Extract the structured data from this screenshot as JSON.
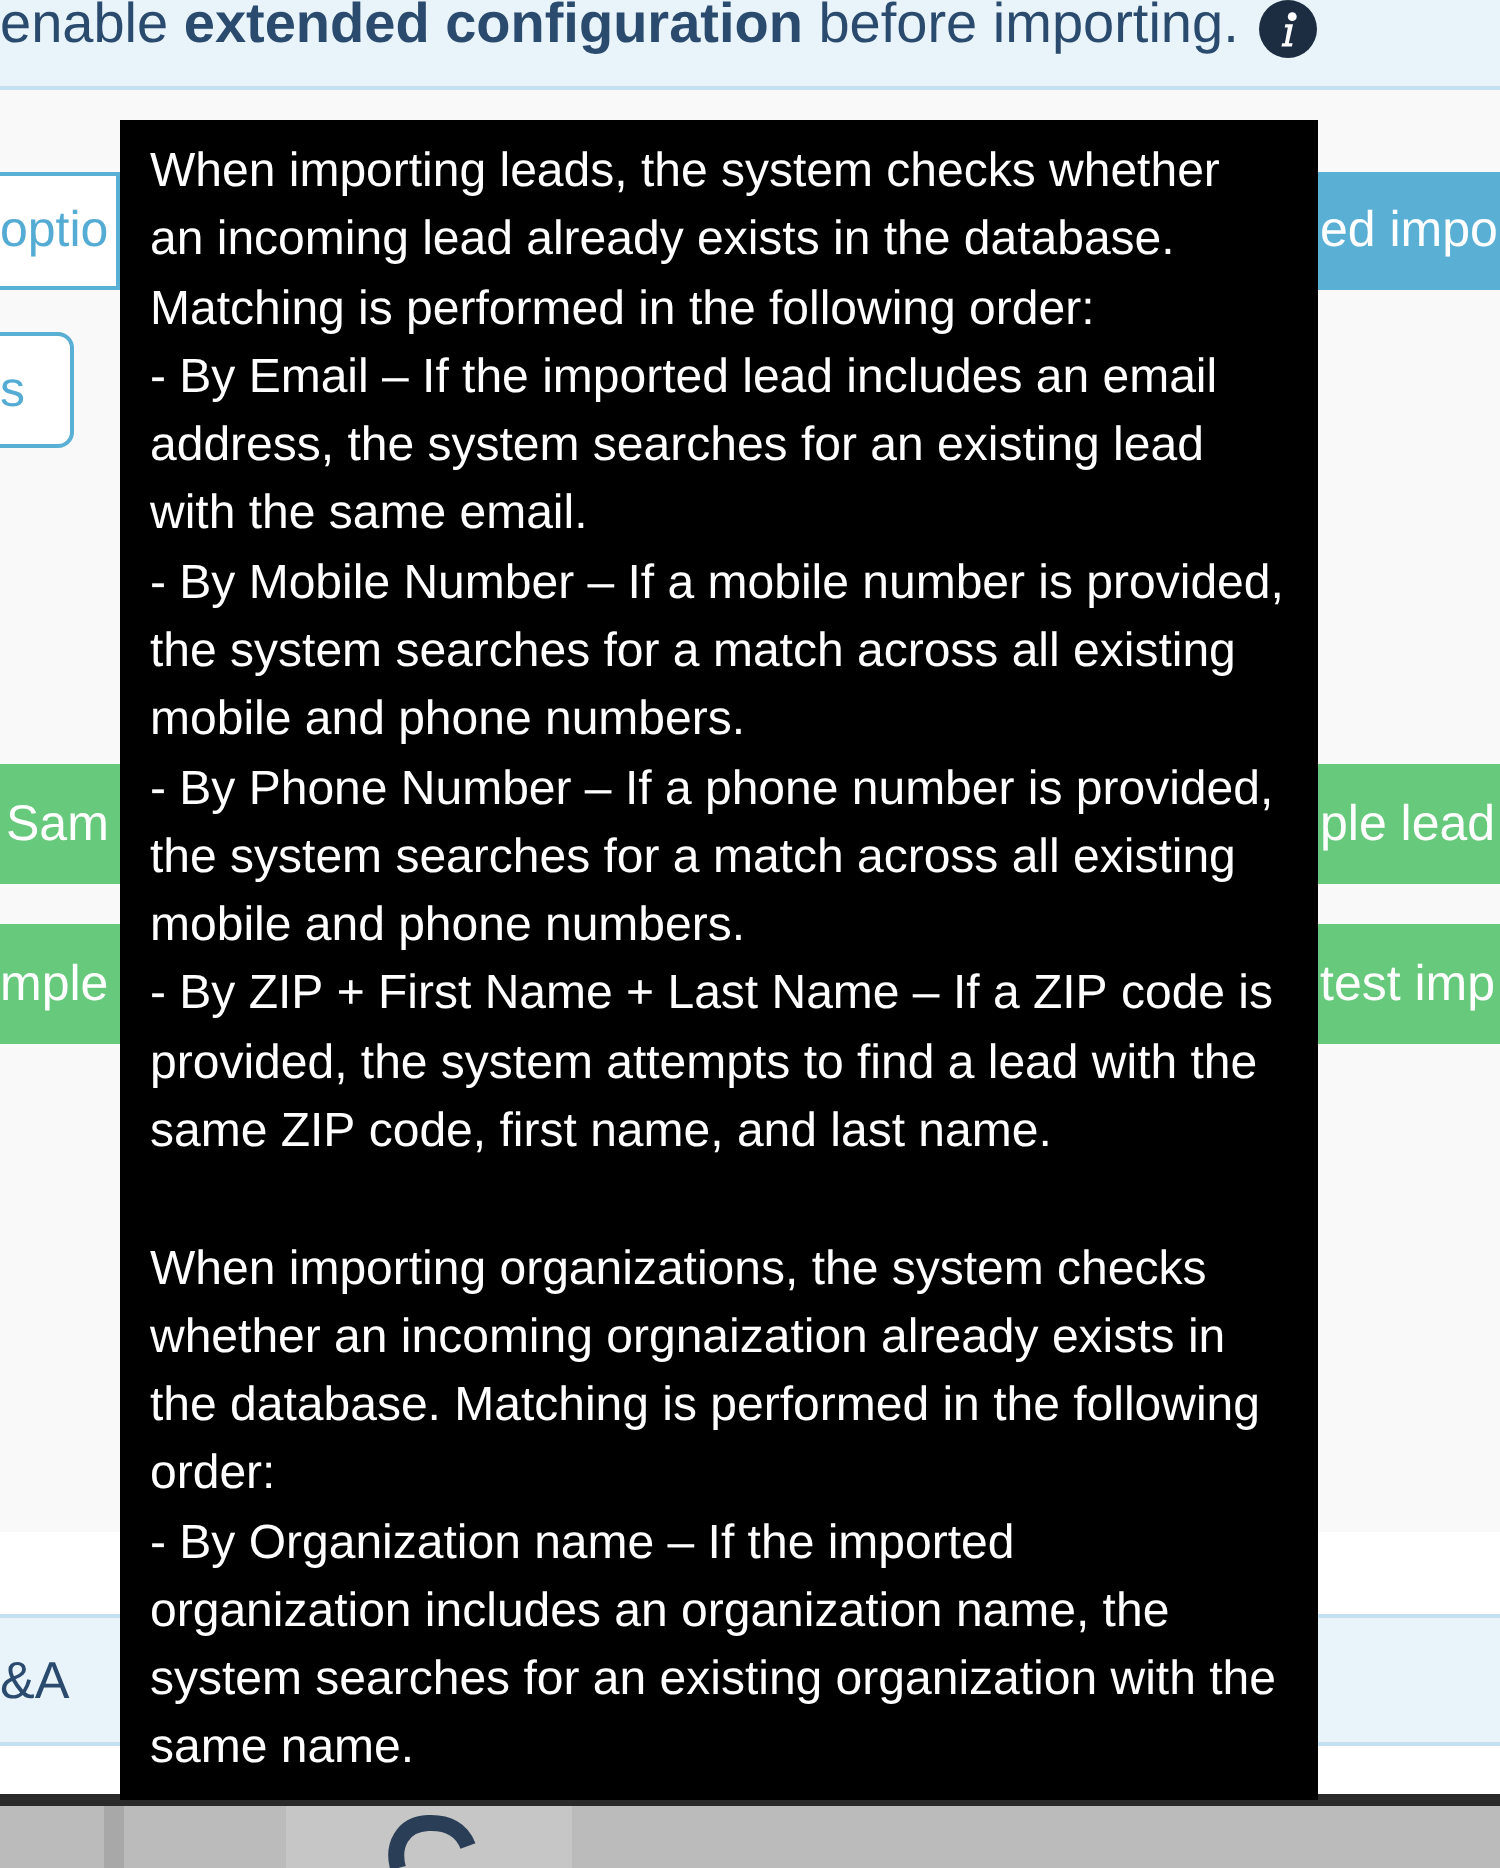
{
  "notice": {
    "text": "enable **extended configuration** before importing."
  },
  "button_rows": [
    {
      "left": {
        "label": "optio",
        "kind": "outline"
      },
      "right": {
        "label": "ed impo",
        "kind": "primary"
      }
    },
    {
      "left": {
        "label": "s",
        "kind": "outline"
      }
    },
    {
      "left": {
        "label": "Sam",
        "kind": "success"
      },
      "right": {
        "label": "ple lead",
        "kind": "success"
      }
    },
    {
      "left": {
        "label": "mple",
        "kind": "success"
      },
      "right": {
        "label": "test imp",
        "kind": "success"
      }
    }
  ],
  "list_row": {
    "label": "&A"
  },
  "tooltip": {
    "sections": [
      {
        "intro": "When importing leads, the system checks whether an incoming lead already exists in the database. Matching is performed in the following order:",
        "rules": [
          "- By Email – If the imported lead includes an email address, the system searches for an existing lead with the same email.",
          "- By Mobile Number – If a mobile number is provided, the system searches for a match across all existing mobile and phone numbers.",
          "- By Phone Number – If a phone number is provided, the system searches for a match across all existing mobile and phone numbers.",
          "- By ZIP + First Name + Last Name – If a ZIP code is provided, the system attempts to find a lead with the same ZIP code, first name, and last name."
        ]
      },
      {
        "intro": "When importing organizations, the system checks whether an incoming orgnaization already exists in the database. Matching is performed in the following order:",
        "rules": [
          "- By Organization name – If the imported organization includes an organization name, the system searches for an existing organization with the same name."
        ]
      }
    ]
  }
}
